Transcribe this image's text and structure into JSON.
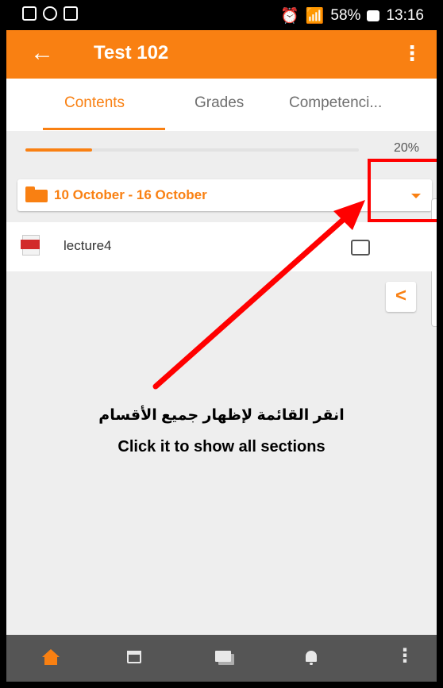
{
  "status_bar": {
    "battery": "58%",
    "time": "13:16"
  },
  "app_bar": {
    "back_icon": "arrow-back-icon",
    "title": "Test 102",
    "more_icon": "more-vert-icon"
  },
  "tabs": [
    {
      "label": "Contents",
      "selected": true
    },
    {
      "label": "Grades",
      "selected": false
    },
    {
      "label": "Competenci...",
      "selected": false
    }
  ],
  "progress": {
    "value_fraction": 0.2,
    "label": "20%"
  },
  "section_selector": {
    "label": "10 October - 16 October",
    "icon": "folder-icon",
    "caret": "caret-down-icon"
  },
  "content_items": [
    {
      "name": "lecture4",
      "icon": "pdf-icon",
      "completed": false
    }
  ],
  "annotation": {
    "text_ar": "انقر القائمة لإظهار جميع الأقسام",
    "text_en": "Click it to show all sections"
  },
  "bottom_nav": [
    {
      "icon": "home-icon",
      "active": true
    },
    {
      "icon": "calendar-icon",
      "active": false
    },
    {
      "icon": "messages-icon",
      "active": false
    },
    {
      "icon": "notifications-icon",
      "active": false
    },
    {
      "icon": "more-vert-icon",
      "active": false
    }
  ],
  "colors": {
    "accent": "#f98012",
    "annotation_red": "#ff0000",
    "nav_bg": "#555555"
  }
}
